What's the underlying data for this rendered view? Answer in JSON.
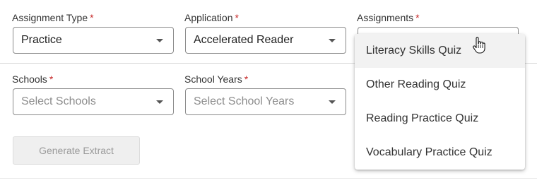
{
  "assignment_type": {
    "label": "Assignment Type",
    "required": "*",
    "value": "Practice"
  },
  "application": {
    "label": "Application",
    "required": "*",
    "value": "Accelerated Reader"
  },
  "assignments": {
    "label": "Assignments",
    "required": "*",
    "value": ""
  },
  "schools": {
    "label": "Schools",
    "required": "*",
    "placeholder": "Select Schools"
  },
  "school_years": {
    "label": "School Years",
    "required": "*",
    "placeholder": "Select School Years"
  },
  "generate_button": {
    "label": "Generate Extract",
    "disabled": true
  },
  "assignments_menu": {
    "options": [
      {
        "label": "Literacy Skills Quiz",
        "hovered": true
      },
      {
        "label": "Other Reading Quiz"
      },
      {
        "label": "Reading Practice Quiz"
      },
      {
        "label": "Vocabulary Practice Quiz"
      }
    ]
  },
  "colors": {
    "required": "#c62828",
    "border": "#8a8a8a",
    "disabled_bg": "#efefef",
    "disabled_text": "#9a9a9a"
  },
  "cursor": {
    "type": "hand-pointer-icon"
  }
}
